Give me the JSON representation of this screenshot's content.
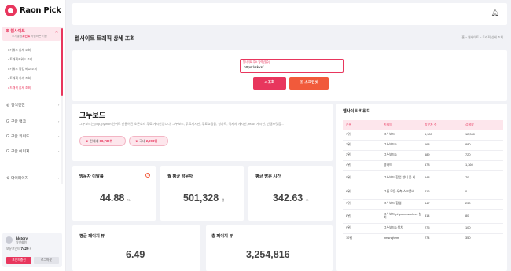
{
  "app": {
    "name": "Raon Pick",
    "brand_color": "#e8365d"
  },
  "sidebar": {
    "active_section": {
      "label": "웹사이트",
      "sub_prefix": "무기놓점",
      "sub_highlight": "포인트",
      "sub_suffix": " 차감하는 기능"
    },
    "sub_items": [
      "키워드 상세 조회",
      "트래픽키워드 조회",
      "키워드 랭킹 비교 조회",
      "트래픽 지수 조회",
      "트래픽 상세 조회"
    ],
    "menu": [
      {
        "label": "검색엔진",
        "icon": "search-engine-icon"
      },
      {
        "label": "구글 랭크",
        "icon": "google-icon"
      },
      {
        "label": "구글 키워드",
        "icon": "google-icon"
      },
      {
        "label": "구글 이미지",
        "icon": "google-icon"
      },
      {
        "label": "마이페이지",
        "icon": "gear-icon"
      }
    ],
    "user": {
      "name": "hlstory",
      "role": "일반회원",
      "point_label": "보유포인트",
      "points": "7429",
      "point_unit": "P",
      "charge_label": "포인트충전",
      "logout_label": "로그아웃"
    }
  },
  "header": {
    "page_title": "웹사이트 트래픽 상세 조회",
    "breadcrumb": "홈 > 웹사이트 > 트래픽 상세 조회"
  },
  "search": {
    "label": "웹사이트 주소 입력 (필수)",
    "value": "https://skks/",
    "search_label": "조회",
    "capture_label": "스크린샷"
  },
  "site": {
    "name": "그누보드",
    "description": "그누보드는 php, python 언어로 만들어진 오픈소스 무료 게시판입니다. 그누보드, 무료게시판, 무료쇼핑몰, 영카트, 국제사 게시판, react 게시판, 빈템프릿등...",
    "global_rank_label": "전세계 ",
    "global_rank": "88,730위",
    "country_rank_label": "국내 ",
    "country_rank": "2,298위"
  },
  "stats": [
    {
      "label": "방문자 이탈률",
      "value": "44.88",
      "unit": "%"
    },
    {
      "label": "월 평균 방문자",
      "value": "501,328",
      "unit": "명"
    },
    {
      "label": "평균 방문 시간",
      "value": "342.63",
      "unit": "초"
    },
    {
      "label": "평균 페이지 뷰",
      "value": "6.49",
      "unit": ""
    },
    {
      "label": "총 페이지 뷰",
      "value": "3,254,816",
      "unit": ""
    }
  ],
  "keywords": {
    "title": "웹사이트 키워드",
    "columns": [
      "순위",
      "키워드",
      "방문자 수",
      "검색량"
    ],
    "rows": [
      [
        "1위",
        "그누보드",
        "6,983",
        "12,360"
      ],
      [
        "2위",
        "그누보드5",
        "668",
        "880"
      ],
      [
        "3위",
        "그누보드6",
        "589",
        "720"
      ],
      [
        "4위",
        "영카트",
        "578",
        "1,360"
      ],
      [
        "5위",
        "그누보드 합업 언니 줄 세",
        "548",
        "70"
      ],
      [
        "6위",
        "그룹 모든 우측 스크롤바",
        "416",
        "0"
      ],
      [
        "7위",
        "그누보드 합업",
        "347",
        "230"
      ],
      [
        "8위",
        "그누보드 phpspreadsheet 설치",
        "314",
        "80"
      ],
      [
        "9위",
        "그누보드6 설치",
        "275",
        "100"
      ],
      [
        "10위",
        "nmsnqhem",
        "274",
        "350"
      ]
    ]
  }
}
